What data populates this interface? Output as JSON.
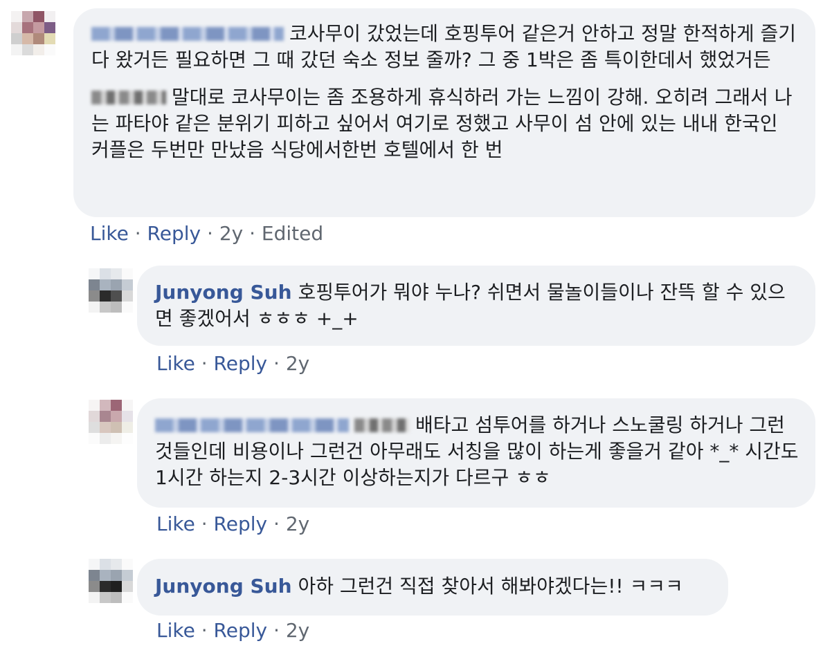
{
  "comments": [
    {
      "paragraphs": [
        "코사무이 갔었는데 호핑투어 같은거 안하고 정말 한적하게 즐기다 왔거든 필요하면 그 때 갔던 숙소 정보 줄까? 그 중 1박은 좀 특이한데서 했었거든",
        "말대로 코사무이는 좀 조용하게 휴식하러 가는 느낌이 강해. 오히려 그래서 나는 파타야 같은 분위기 피하고 싶어서 여기로 정했고 사무이 섬 안에 있는 내내 한국인 커플은 두번만 만났음 식당에서한번 호텔에서 한 번"
      ],
      "like": "Like",
      "reply": "Reply",
      "time": "2y",
      "edited": "Edited"
    },
    {
      "author": "Junyong Suh",
      "text": "호핑투어가 뭐야 누나? 쉬면서 물놀이들이나 잔뜩 할 수 있으면 좋겠어서 ㅎㅎㅎ +_+",
      "like": "Like",
      "reply": "Reply",
      "time": "2y"
    },
    {
      "text": "배타고 섬투어를 하거나 스노쿨링 하거나 그런것들인데 비용이나 그런건 아무래도 서칭을 많이 하는게 좋을거 같아 *_* 시간도 1시간 하는지 2-3시간 이상하는지가 다르구 ㅎㅎ",
      "like": "Like",
      "reply": "Reply",
      "time": "2y"
    },
    {
      "author": "Junyong Suh",
      "text": "아하 그런건 직접 찾아서 해봐야겠다는!! ㅋㅋㅋ",
      "like": "Like",
      "reply": "Reply",
      "time": "2y"
    }
  ],
  "separator": "·",
  "colors": {
    "bubble_bg": "#f0f2f5",
    "link": "#385898",
    "meta": "#606770",
    "text": "#1c1e21"
  }
}
